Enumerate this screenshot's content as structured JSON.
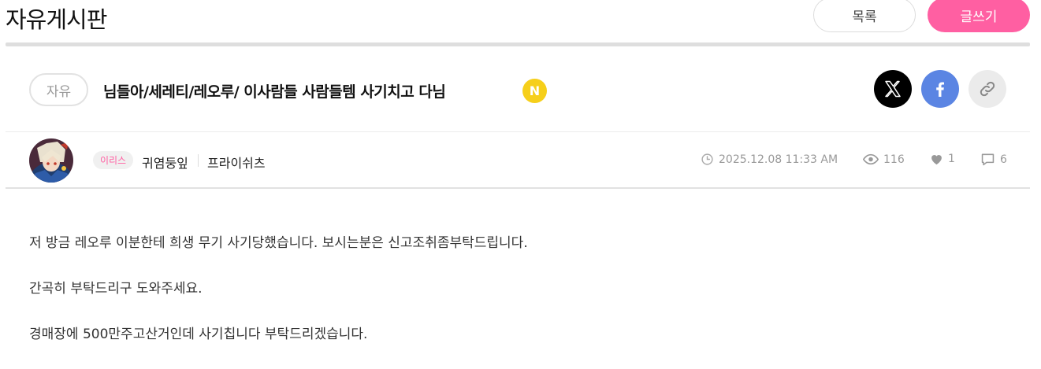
{
  "board": {
    "title": "자유게시판"
  },
  "buttons": {
    "list_label": "목록",
    "write_label": "글쓰기",
    "write_color": "#ff5fa2"
  },
  "post": {
    "category": "자유",
    "title": "님들아/세레티/레오루/ 이사람들 사람들템 사기치고 다님",
    "new_badge": "N",
    "new_badge_color": "#f6cf1a",
    "author": {
      "server": "이리스",
      "nickname": "귀염둥잎",
      "character": "프라이쉬츠"
    },
    "date": "2025.12.08 11:33 AM",
    "views": "116",
    "likes": "1",
    "comments": "6",
    "body": [
      "저 방금 레오루 이분한테 희생 무기 사기당했습니다. 보시는분은 신고조취좀부탁드립니다.",
      "간곡히 부탁드리구 도와주세요.",
      "경매장에 500만주고산거인데 사기칩니다 부탁드리겠습니다."
    ]
  },
  "share": {
    "icons": [
      "x-logo-icon",
      "facebook-icon",
      "link-icon"
    ],
    "x_color": "#000000",
    "facebook_color": "#5b85e3",
    "link_color": "#ebebeb"
  },
  "meta_icons": [
    "clock-icon",
    "eye-icon",
    "heart-icon",
    "comment-icon"
  ]
}
